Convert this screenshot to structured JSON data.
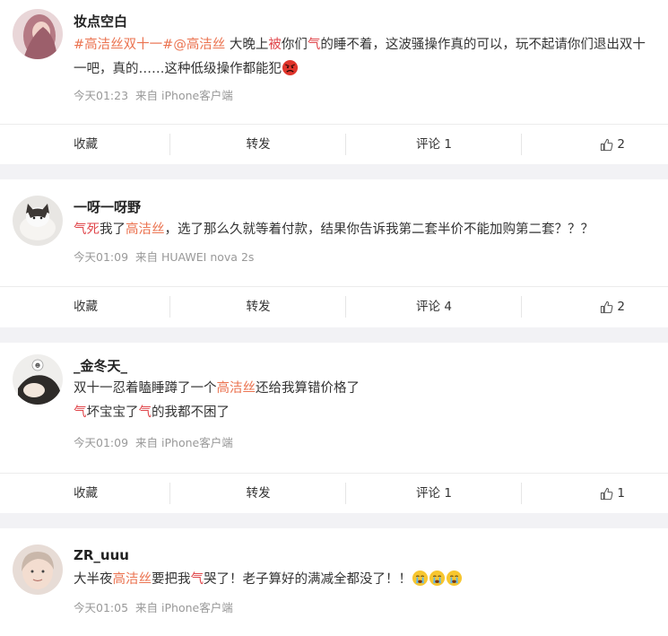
{
  "posts": [
    {
      "username": "妆点空白",
      "segments": [
        {
          "t": "#高洁丝双十一#",
          "c": "hashtag"
        },
        {
          "t": "@高洁丝",
          "c": "hashtag"
        },
        {
          "t": " 大晚上",
          "c": ""
        },
        {
          "t": "被",
          "c": "red"
        },
        {
          "t": "你们",
          "c": ""
        },
        {
          "t": "气",
          "c": "red"
        },
        {
          "t": "的睡不着，这波骚操作真的可以，玩不起请你们退出双十一吧，真的……这种低级操作都能犯",
          "c": ""
        }
      ],
      "emoji": [
        "angry-face"
      ],
      "time": "今天01:23",
      "source": "来自 iPhone客户端",
      "actions": {
        "fav": "收藏",
        "repost": "转发",
        "comment": "评论 1",
        "like": "2"
      }
    },
    {
      "username": "一呀一呀野",
      "segments": [
        {
          "t": "气死",
          "c": "red"
        },
        {
          "t": "我了",
          "c": ""
        },
        {
          "t": "高洁丝",
          "c": "hl"
        },
        {
          "t": "，选了那么久就等着付款，结果你告诉我第二套半价不能加购第二套？？？",
          "c": ""
        }
      ],
      "emoji": [],
      "time": "今天01:09",
      "source": "来自 HUAWEI nova 2s",
      "actions": {
        "fav": "收藏",
        "repost": "转发",
        "comment": "评论 4",
        "like": "2"
      }
    },
    {
      "username": "_金冬天_",
      "segments": [
        {
          "t": "双十一忍着瞌睡蹲了一个",
          "c": ""
        },
        {
          "t": "高洁丝",
          "c": "hl"
        },
        {
          "t": "还给我算错价格了",
          "c": ""
        },
        {
          "t": "\n",
          "c": "br"
        },
        {
          "t": "气",
          "c": "red"
        },
        {
          "t": "坏宝宝了",
          "c": ""
        },
        {
          "t": "气",
          "c": "red"
        },
        {
          "t": "的我都不困了",
          "c": ""
        }
      ],
      "emoji": [],
      "time": "今天01:09",
      "source": "来自 iPhone客户端",
      "actions": {
        "fav": "收藏",
        "repost": "转发",
        "comment": "评论 1",
        "like": "1"
      }
    },
    {
      "username": "ZR_uuu",
      "segments": [
        {
          "t": "大半夜",
          "c": ""
        },
        {
          "t": "高洁丝",
          "c": "hl"
        },
        {
          "t": "要把我",
          "c": ""
        },
        {
          "t": "气",
          "c": "red"
        },
        {
          "t": "哭了！老子算好的满减全都没了！！",
          "c": ""
        }
      ],
      "emoji": [
        "crying-face",
        "crying-face",
        "crying-face"
      ],
      "time": "今天01:05",
      "source": "来自 iPhone客户端",
      "actions": null
    }
  ]
}
